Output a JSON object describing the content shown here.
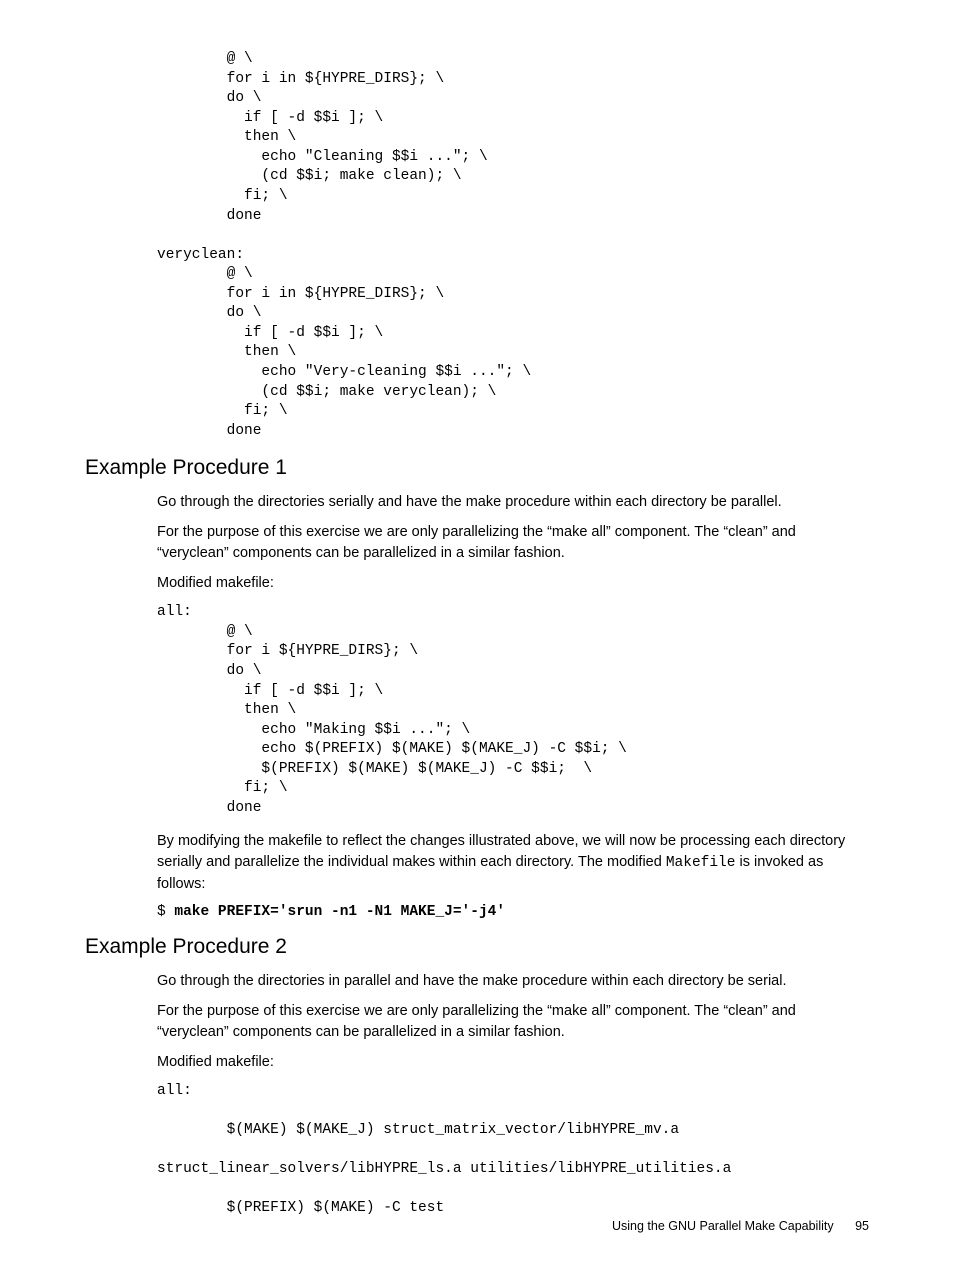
{
  "code_block_1": "        @ \\\n        for i in ${HYPRE_DIRS}; \\\n        do \\\n          if [ -d $$i ]; \\\n          then \\\n            echo \"Cleaning $$i ...\"; \\\n            (cd $$i; make clean); \\\n          fi; \\\n        done\n\nveryclean:\n        @ \\\n        for i in ${HYPRE_DIRS}; \\\n        do \\\n          if [ -d $$i ]; \\\n          then \\\n            echo \"Very-cleaning $$i ...\"; \\\n            (cd $$i; make veryclean); \\\n          fi; \\\n        done",
  "heading_1": "Example Procedure 1",
  "para_1a": "Go through the directories serially and have the make procedure within each directory be parallel.",
  "para_1b": "For the purpose of this exercise we are only parallelizing the “make all” component. The “clean” and “veryclean” components can be parallelized in a similar fashion.",
  "para_1c": "Modified makefile:",
  "code_block_2": "all:\n        @ \\\n        for i ${HYPRE_DIRS}; \\\n        do \\\n          if [ -d $$i ]; \\\n          then \\\n            echo \"Making $$i ...\"; \\\n            echo $(PREFIX) $(MAKE) $(MAKE_J) -C $$i; \\\n            $(PREFIX) $(MAKE) $(MAKE_J) -C $$i;  \\\n          fi; \\\n        done",
  "para_1d_pre": "By modifying the makefile to reflect the changes illustrated above, we will now be processing each directory serially and parallelize the individual makes within each directory. The modified ",
  "para_1d_mono": "Makefile",
  "para_1d_post": " is invoked as follows:",
  "cmd_1_prompt": "$ ",
  "cmd_1_bold": "make PREFIX='srun -n1 -N1 MAKE_J='-j4'",
  "heading_2": "Example Procedure 2",
  "para_2a": "Go through the directories in parallel and have the make procedure within each directory be serial.",
  "para_2b": "For the purpose of this exercise we are only parallelizing the “make all” component. The “clean” and “veryclean” components can be parallelized in a similar fashion.",
  "para_2c": "Modified makefile:",
  "code_block_3": "all:\n\n        $(MAKE) $(MAKE_J) struct_matrix_vector/libHYPRE_mv.a\n\nstruct_linear_solvers/libHYPRE_ls.a utilities/libHYPRE_utilities.a\n\n        $(PREFIX) $(MAKE) -C test",
  "footer_text": "Using the GNU Parallel Make Capability",
  "page_number": "95"
}
